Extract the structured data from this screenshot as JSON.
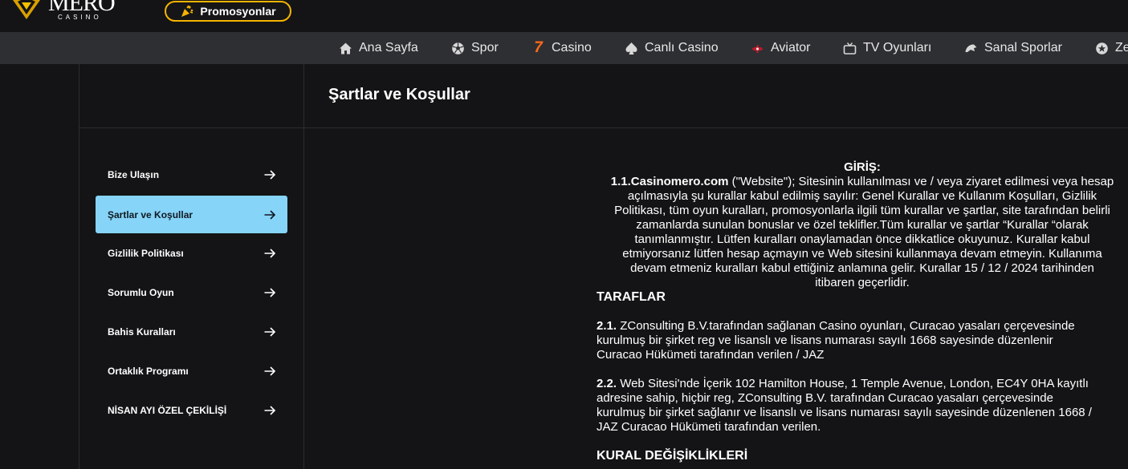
{
  "header": {
    "logo_text": "MERO",
    "logo_sub": "CASINO",
    "promo_label": "Promosyonlar"
  },
  "nav": {
    "items": [
      {
        "label": "Ana Sayfa",
        "icon": "home-icon"
      },
      {
        "label": "Spor",
        "icon": "soccer-ball-icon"
      },
      {
        "label": "Casino",
        "icon": "seven-icon",
        "glyph": "7"
      },
      {
        "label": "Canlı Casino",
        "icon": "spade-icon"
      },
      {
        "label": "Aviator",
        "icon": "aviator-icon"
      },
      {
        "label": "TV Oyunları",
        "icon": "tv-icon"
      },
      {
        "label": "Sanal Sporlar",
        "icon": "virtual-sports-icon"
      },
      {
        "label": "Ze",
        "icon": "star-icon"
      }
    ]
  },
  "page_title": "Şartlar ve Koşullar",
  "sidebar": {
    "items": [
      {
        "label": "Bize Ulaşın",
        "active": false
      },
      {
        "label": "Şartlar ve Koşullar",
        "active": true
      },
      {
        "label": "Gizlilik Politikası",
        "active": false
      },
      {
        "label": "Sorumlu Oyun",
        "active": false
      },
      {
        "label": "Bahis Kuralları",
        "active": false
      },
      {
        "label": "Ortaklık Programı",
        "active": false
      },
      {
        "label": "NİSAN AYI ÖZEL ÇEKİLİŞİ",
        "active": false
      }
    ]
  },
  "content": {
    "intro_title": "GİRİŞ:",
    "p1_bold": "1.1.Casinomero.com",
    "p1_lines": [
      " (\"Website\"); Sitesinin kullanılması ve / veya ziyaret edilmesi veya hesap",
      "açılmasıyla şu kurallar kabul edilmiş sayılır: Genel Kurallar ve Kullanım Koşulları, Gizlilik",
      "Politikası, tüm oyun kuralları, promosyonlarla ilgili tüm kurallar ve şartlar, site tarafından belirli",
      "zamanlarda sunulan bonuslar ve özel teklifler.Tüm kurallar ve şartlar “Kurallar “olarak",
      "tanımlanmıştır. Lütfen kuralları onaylamadan önce dikkatlice okuyunuz. Kurallar kabul",
      "etmiyorsanız lütfen hesap açmayın ve Web sitesini kullanmaya devam etmeyin. Kullanıma",
      "devam etmeniz kuralları kabul ettiğiniz anlamına gelir. Kurallar 15 / 12 / 2024 tarihinden",
      "itibaren geçerlidir."
    ],
    "section_parties": "TARAFLAR",
    "p21_bold": "2.1.",
    "p21_lines": [
      " ZConsulting B.V.tarafından sağlanan Casino oyunları, Curacao yasaları çerçevesinde",
      "kurulmuş bir şirket reg ve lisanslı ve lisans numarası sayılı 1668 sayesinde düzenlenir",
      "Curacao Hükümeti tarafından verilen / JAZ"
    ],
    "p22_bold": "2.2.",
    "p22_lines": [
      " Web Sitesi'nde İçerik 102 Hamilton House, 1 Temple Avenue, London, EC4Y 0HA kayıtlı",
      "adresine sahip, hiçbir reg, ZConsulting B.V. tarafından Curacao yasaları çerçevesinde",
      "kurulmuş bir şirket sağlanır ve lisanslı ve lisans numarası sayılı sayesinde düzenlenen 1668 /",
      "JAZ Curacao Hükümeti tarafından verilen."
    ],
    "section_changes": "KURAL DEĞİŞİKLİKLERİ"
  },
  "colors": {
    "accent_gold": "#f5b400",
    "active_item": "#86d4f8",
    "nav_bg": "#2e2f33",
    "page_bg": "#141416"
  }
}
